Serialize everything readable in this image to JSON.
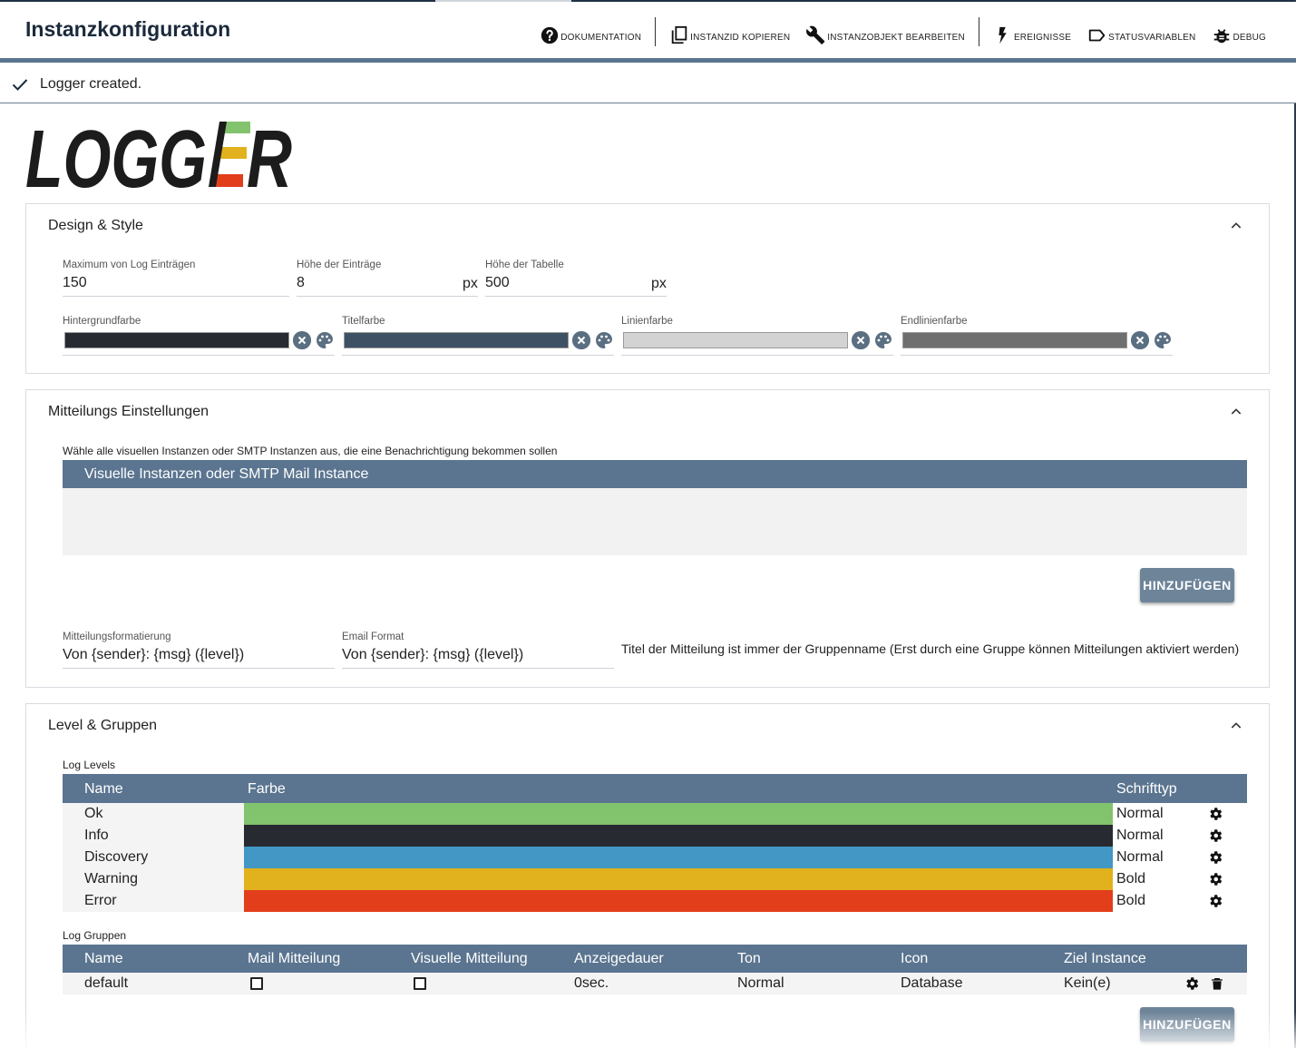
{
  "header": {
    "title": "Instanzkonfiguration",
    "toolbar": [
      {
        "label": "DOKUMENTATION",
        "icon": "help-circle-icon"
      },
      {
        "label": "INSTANZID KOPIEREN",
        "icon": "copy-icon"
      },
      {
        "label": "INSTANZOBJEKT BEARBEITEN",
        "icon": "wrench-icon"
      },
      {
        "label": "EREIGNISSE",
        "icon": "lightning-icon"
      },
      {
        "label": "STATUSVARIABLEN",
        "icon": "tag-icon"
      },
      {
        "label": "DEBUG",
        "icon": "bug-icon"
      }
    ]
  },
  "notification": {
    "text": "Logger created."
  },
  "logo": {
    "text": "LOGGER"
  },
  "design": {
    "title": "Design & Style",
    "max_entries_label": "Maximum von Log Einträgen",
    "max_entries_value": "150",
    "entry_height_label": "Höhe der Einträge",
    "entry_height_value": "8",
    "entry_height_unit": "px",
    "table_height_label": "Höhe der Tabelle",
    "table_height_value": "500",
    "table_height_unit": "px",
    "colors": [
      {
        "label": "Hintergrundfarbe",
        "value": "#272a31"
      },
      {
        "label": "Titelfarbe",
        "value": "#3e5064"
      },
      {
        "label": "Linienfarbe",
        "value": "#d3d3d3"
      },
      {
        "label": "Endlinienfarbe",
        "value": "#6f6f6f"
      }
    ]
  },
  "messages": {
    "title": "Mitteilungs Einstellungen",
    "instances_label": "Wähle alle visuellen Instanzen oder SMTP Instanzen aus, die eine Benachrichtigung bekommen sollen",
    "instances_header": "Visuelle Instanzen oder SMTP Mail Instance",
    "add_button": "HINZUFÜGEN",
    "format_label": "Mitteilungsformatierung",
    "format_value": "Von {sender}: {msg} ({level})",
    "email_label": "Email Format",
    "email_value": "Von {sender}: {msg} ({level})",
    "note": "Titel der Mitteilung ist immer der Gruppenname (Erst durch eine Gruppe können Mitteilungen aktiviert werden)"
  },
  "levels": {
    "title": "Level & Gruppen",
    "log_levels_label": "Log Levels",
    "columns": {
      "name": "Name",
      "color": "Farbe",
      "font": "Schrifttyp"
    },
    "rows": [
      {
        "name": "Ok",
        "color": "#82c36e",
        "font": "Normal"
      },
      {
        "name": "Info",
        "color": "#272a31",
        "font": "Normal"
      },
      {
        "name": "Discovery",
        "color": "#4297c4",
        "font": "Normal"
      },
      {
        "name": "Warning",
        "color": "#e1b21e",
        "font": "Bold"
      },
      {
        "name": "Error",
        "color": "#e23e1c",
        "font": "Bold"
      }
    ],
    "groups_label": "Log Gruppen",
    "group_columns": [
      "Name",
      "Mail Mitteilung",
      "Visuelle Mitteilung",
      "Anzeigedauer",
      "Ton",
      "Icon",
      "Ziel Instance"
    ],
    "groups": [
      {
        "name": "default",
        "mail": false,
        "visual": false,
        "duration": "0sec.",
        "sound": "Normal",
        "icon": "Database",
        "target": "Kein(e)"
      }
    ],
    "add_button": "HINZUFÜGEN"
  }
}
